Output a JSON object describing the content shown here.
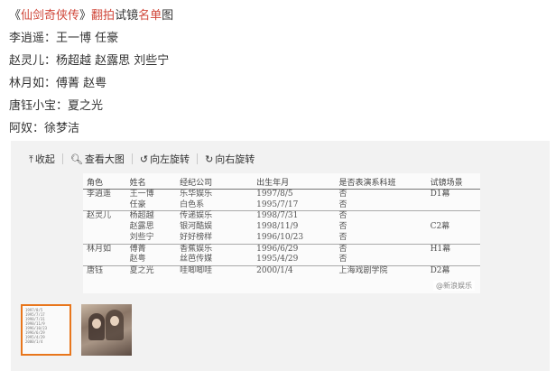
{
  "post": {
    "title_open": "《",
    "title_name": "仙剑奇侠传",
    "title_close": "》",
    "title_mid1": "翻拍",
    "title_mid2": "试镜",
    "title_mid3": "名单",
    "title_end": "图",
    "lines": [
      "李逍遥：王一博 任豪",
      "赵灵儿：杨超越 赵露思 刘些宁",
      "林月如：傅菁 赵粤",
      "唐钰小宝：夏之光",
      "阿奴：徐梦洁"
    ]
  },
  "toolbar": {
    "collapse": "收起",
    "view_large": "查看大图",
    "rotate_left": "向左旋转",
    "rotate_right": "向右旋转"
  },
  "image_table": {
    "headers": [
      "角色",
      "姓名",
      "经纪公司",
      "出生年月",
      "是否表演系科班",
      "试镜场景"
    ],
    "rows": [
      {
        "role": "李逍遥",
        "name": "王一博",
        "company": "乐华娱乐",
        "birth": "1997/8/5",
        "yn": "否",
        "scene": "D1幕",
        "grp": true
      },
      {
        "role": "",
        "name": "任豪",
        "company": "白色系",
        "birth": "1995/7/17",
        "yn": "否",
        "scene": "",
        "grp": false
      },
      {
        "role": "赵灵儿",
        "name": "杨超越",
        "company": "传递娱乐",
        "birth": "1998/7/31",
        "yn": "否",
        "scene": "",
        "grp": true
      },
      {
        "role": "",
        "name": "赵露思",
        "company": "银河酷娱",
        "birth": "1998/11/9",
        "yn": "否",
        "scene": "C2幕",
        "grp": false
      },
      {
        "role": "",
        "name": "刘些宁",
        "company": "好好榜样",
        "birth": "1996/10/23",
        "yn": "否",
        "scene": "",
        "grp": false
      },
      {
        "role": "林月如",
        "name": "傅菁",
        "company": "香蕉娱乐",
        "birth": "1996/6/29",
        "yn": "否",
        "scene": "H1幕",
        "grp": true
      },
      {
        "role": "",
        "name": "赵粤",
        "company": "丝芭传媒",
        "birth": "1995/4/29",
        "yn": "否",
        "scene": "",
        "grp": false
      },
      {
        "role": "唐钰",
        "name": "夏之光",
        "company": "哇唧唧哇",
        "birth": "2000/1/4",
        "yn": "上海戏剧学院",
        "scene": "D2幕",
        "grp": true
      }
    ],
    "watermark": "@新浪娱乐"
  },
  "thumbnails": {
    "thumb1_lines": [
      "1997/8/5",
      "1995/7/17",
      "1998/7/31",
      "1998/11/9",
      "1996/10/23",
      "1996/6/29",
      "1995/4/29",
      "2000/1/4"
    ]
  },
  "colors": {
    "accent_red": "#d0473a",
    "thumb_selected": "#e8761c",
    "viewer_bg": "#f2f2f2"
  }
}
